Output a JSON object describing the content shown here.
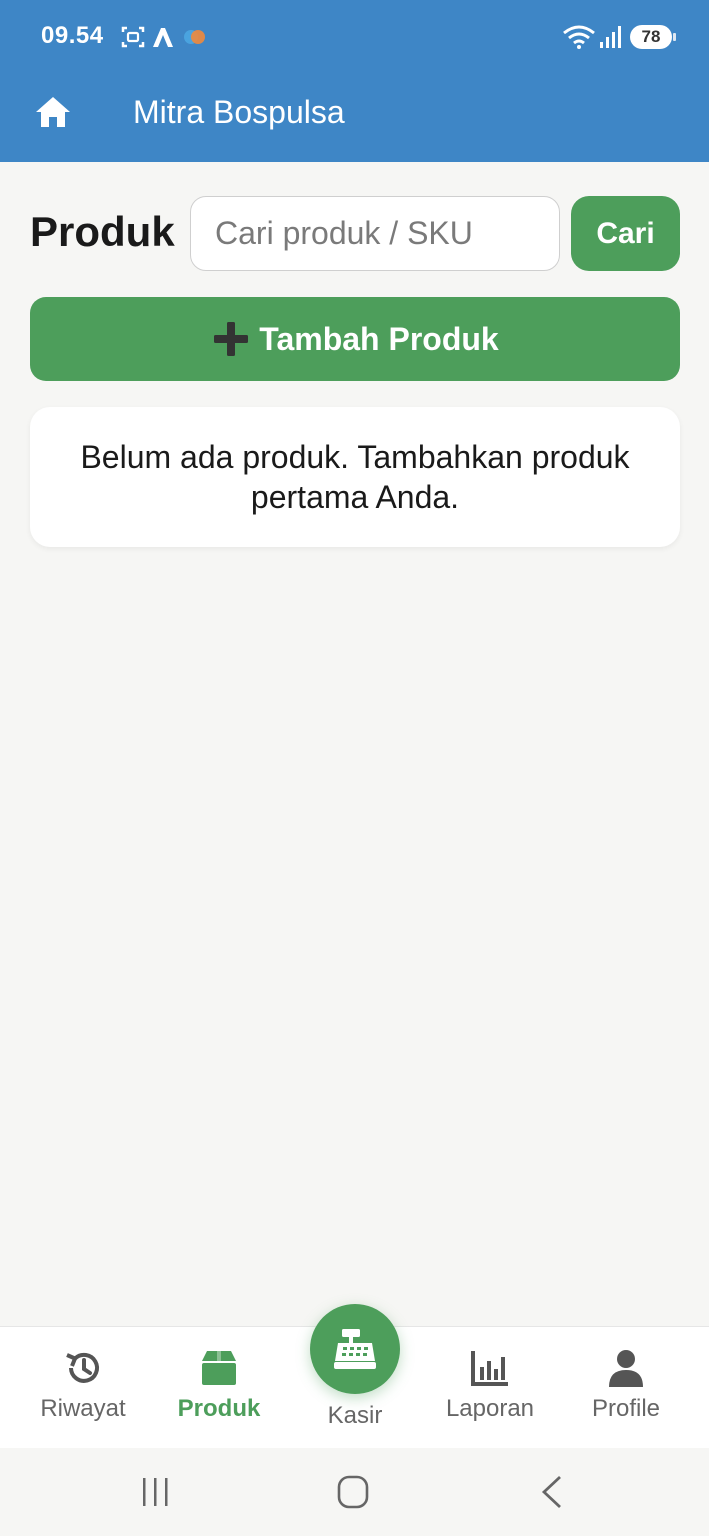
{
  "status_bar": {
    "time": "09.54",
    "battery": "78"
  },
  "app_bar": {
    "title": "Mitra Bospulsa",
    "home_icon": "home-icon"
  },
  "main": {
    "title": "Produk",
    "search": {
      "placeholder": "Cari produk / SKU",
      "value": "",
      "button_label": "Cari"
    },
    "add_button_label": "Tambah Produk",
    "empty_message": "Belum ada produk. Tambahkan produk pertama Anda."
  },
  "bottom_nav": {
    "items": [
      {
        "label": "Riwayat",
        "icon": "history-icon",
        "active": false
      },
      {
        "label": "Produk",
        "icon": "box-icon",
        "active": true
      },
      {
        "label": "Kasir",
        "icon": "cash-register-icon",
        "active": false
      },
      {
        "label": "Laporan",
        "icon": "chart-icon",
        "active": false
      },
      {
        "label": "Profile",
        "icon": "user-icon",
        "active": false
      }
    ]
  },
  "colors": {
    "primary_blue": "#3e86c6",
    "accent_green": "#4d9e5b",
    "background": "#f6f6f4",
    "inactive_text": "#666666"
  }
}
